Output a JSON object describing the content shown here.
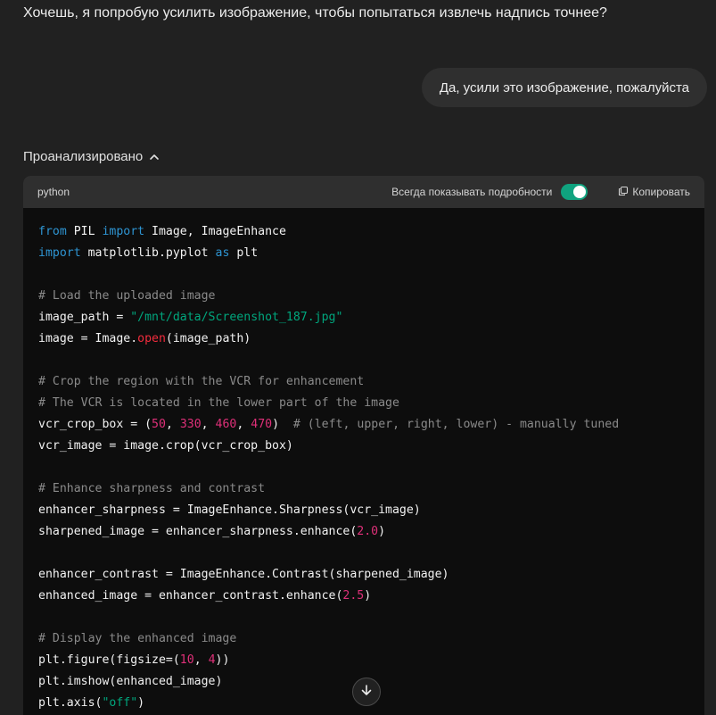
{
  "assistant_message": "Хочешь, я попробую усилить изображение, чтобы попытаться извлечь надпись точнее?",
  "user_message": "Да, усили это изображение, пожалуйста",
  "analysis": {
    "label": "Проанализировано",
    "icon": "chevron-up-icon"
  },
  "code_block": {
    "language": "python",
    "toggle_label": "Всегда показывать подробности",
    "toggle_on": true,
    "toggle_color": "#10a37f",
    "copy_label": "Копировать",
    "copy_icon": "copy-icon",
    "lines": [
      [
        {
          "t": "from",
          "c": "kw"
        },
        {
          "t": " PIL "
        },
        {
          "t": "import",
          "c": "kw"
        },
        {
          "t": " Image, ImageEnhance"
        }
      ],
      [
        {
          "t": "import",
          "c": "kw"
        },
        {
          "t": " matplotlib.pyplot "
        },
        {
          "t": "as",
          "c": "kw"
        },
        {
          "t": " plt"
        }
      ],
      [],
      [
        {
          "t": "# Load the uploaded image",
          "c": "cm"
        }
      ],
      [
        {
          "t": "image_path = "
        },
        {
          "t": "\"/mnt/data/Screenshot_187.jpg\"",
          "c": "str"
        }
      ],
      [
        {
          "t": "image = Image."
        },
        {
          "t": "open",
          "c": "fn"
        },
        {
          "t": "(image_path)"
        }
      ],
      [],
      [
        {
          "t": "# Crop the region with the VCR for enhancement",
          "c": "cm"
        }
      ],
      [
        {
          "t": "# The VCR is located in the lower part of the image",
          "c": "cm"
        }
      ],
      [
        {
          "t": "vcr_crop_box = ("
        },
        {
          "t": "50",
          "c": "num"
        },
        {
          "t": ", "
        },
        {
          "t": "330",
          "c": "num"
        },
        {
          "t": ", "
        },
        {
          "t": "460",
          "c": "num"
        },
        {
          "t": ", "
        },
        {
          "t": "470",
          "c": "num"
        },
        {
          "t": ")  "
        },
        {
          "t": "# (left, upper, right, lower) - manually tuned",
          "c": "cm"
        }
      ],
      [
        {
          "t": "vcr_image = image.crop(vcr_crop_box)"
        }
      ],
      [],
      [
        {
          "t": "# Enhance sharpness and contrast",
          "c": "cm"
        }
      ],
      [
        {
          "t": "enhancer_sharpness = ImageEnhance.Sharpness(vcr_image)"
        }
      ],
      [
        {
          "t": "sharpened_image = enhancer_sharpness.enhance("
        },
        {
          "t": "2.0",
          "c": "num"
        },
        {
          "t": ")"
        }
      ],
      [],
      [
        {
          "t": "enhancer_contrast = ImageEnhance.Contrast(sharpened_image)"
        }
      ],
      [
        {
          "t": "enhanced_image = enhancer_contrast.enhance("
        },
        {
          "t": "2.5",
          "c": "num"
        },
        {
          "t": ")"
        }
      ],
      [],
      [
        {
          "t": "# Display the enhanced image",
          "c": "cm"
        }
      ],
      [
        {
          "t": "plt.figure(figsize=("
        },
        {
          "t": "10",
          "c": "num"
        },
        {
          "t": ", "
        },
        {
          "t": "4",
          "c": "num"
        },
        {
          "t": "))"
        }
      ],
      [
        {
          "t": "plt.imshow(enhanced_image)"
        }
      ],
      [
        {
          "t": "plt.axis("
        },
        {
          "t": "\"off\"",
          "c": "str"
        },
        {
          "t": ")"
        }
      ]
    ]
  },
  "scroll_button_icon": "arrow-down-icon",
  "colors": {
    "background": "#212121",
    "code_background": "#0d0d0d",
    "header_background": "#2f2f2f",
    "keyword": "#2e95d3",
    "comment": "#8a8a8a",
    "string": "#00a67d",
    "number": "#df3079"
  }
}
